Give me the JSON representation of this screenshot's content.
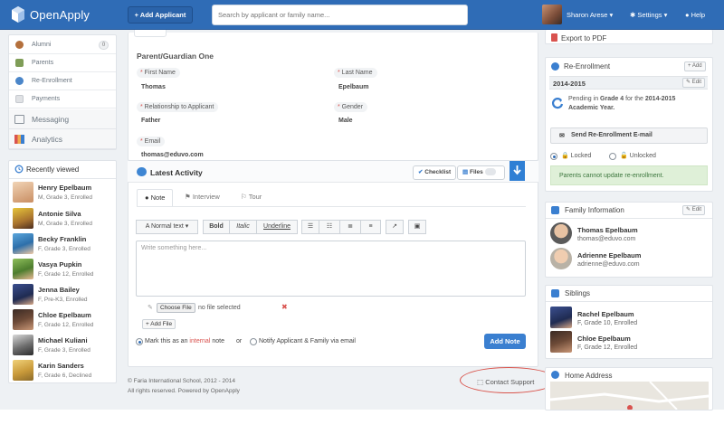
{
  "app": {
    "brand": "OpenApply",
    "add_applicant": "+ Add Applicant",
    "search_placeholder": "Search by applicant or family name...",
    "user": "Sharon Arese",
    "settings": "Settings",
    "help": "Help"
  },
  "nav": {
    "small_items": [
      {
        "label": "Alumni",
        "badge": "0"
      },
      {
        "label": "Parents"
      },
      {
        "label": "Re-Enrollment"
      },
      {
        "label": "Payments"
      }
    ],
    "big_items": [
      {
        "label": "Messaging"
      },
      {
        "label": "Analytics"
      }
    ]
  },
  "recently_viewed": {
    "title": "Recently viewed",
    "items": [
      {
        "name": "Henry Epelbaum",
        "sub": "M, Grade 3, Enrolled"
      },
      {
        "name": "Antonie Silva",
        "sub": "M, Grade 3, Enrolled"
      },
      {
        "name": "Becky Franklin",
        "sub": "F, Grade 3, Enrolled"
      },
      {
        "name": "Vasya Pupkin",
        "sub": "F, Grade 12, Enrolled"
      },
      {
        "name": "Jenna Bailey",
        "sub": "F, Pre-K3, Enrolled"
      },
      {
        "name": "Chloe Epelbaum",
        "sub": "F, Grade 12, Enrolled"
      },
      {
        "name": "Michael Kuliani",
        "sub": "F, Grade 3, Enrolled"
      },
      {
        "name": "Karin Sanders",
        "sub": "F, Grade 6, Declined"
      }
    ]
  },
  "guardian": {
    "title": "Parent/Guardian One",
    "first_name_label": "First Name",
    "first_name": "Thomas",
    "last_name_label": "Last Name",
    "last_name": "Epelbaum",
    "relationship_label": "Relationship to Applicant",
    "relationship": "Father",
    "gender_label": "Gender",
    "gender": "Male",
    "email_label": "Email",
    "email": "thomas@eduvo.com"
  },
  "activity": {
    "title": "Latest Activity",
    "checklist": "Checklist",
    "files": "Files",
    "tabs": [
      "Note",
      "Interview",
      "Tour"
    ],
    "toolbar": {
      "normal_text": "Normal text",
      "bold": "Bold",
      "italic": "Italic",
      "underline": "Underline"
    },
    "placeholder": "Write something here...",
    "choose_file": "Choose File",
    "no_file": "no file selected",
    "add_file": "+ Add File",
    "mark_internal_pre": "Mark this as an",
    "internal": "internal",
    "note_word": "note",
    "or": "or",
    "notify": "Notify Applicant & Family via email",
    "add_note": "Add Note"
  },
  "footer": {
    "line1": "© Faria International School, 2012 - 2014",
    "line2": "All rights reserved. Powered by OpenApply",
    "contact": "Contact Support"
  },
  "right": {
    "export_pdf": "Export to PDF",
    "reenrollment": {
      "title": "Re-Enrollment",
      "add": "Add",
      "year": "2014-2015",
      "edit": "Edit",
      "pending_1": "Pending in",
      "grade": "Grade 4",
      "pending_2": "for the",
      "year_bold": "2014-2015",
      "pending_3": "Academic Year.",
      "send": "Send Re-Enrollment E-mail",
      "locked": "Locked",
      "unlocked": "Unlocked",
      "notice": "Parents cannot update re-enrollment."
    },
    "family": {
      "title": "Family Information",
      "edit": "Edit",
      "members": [
        {
          "name": "Thomas Epelbaum",
          "email": "thomas@eduvo.com"
        },
        {
          "name": "Adrienne Epelbaum",
          "email": "adrienne@eduvo.com"
        }
      ]
    },
    "siblings": {
      "title": "Siblings",
      "items": [
        {
          "name": "Rachel Epelbaum",
          "sub": "F, Grade 10, Enrolled"
        },
        {
          "name": "Chloe Epelbaum",
          "sub": "F, Grade 12, Enrolled"
        }
      ]
    },
    "home_address": "Home Address"
  },
  "colors": {
    "brand": "#2f6cb6",
    "accent": "#3a7fd0",
    "required": "#d9534f",
    "highlight_oval": "#d9544c"
  }
}
